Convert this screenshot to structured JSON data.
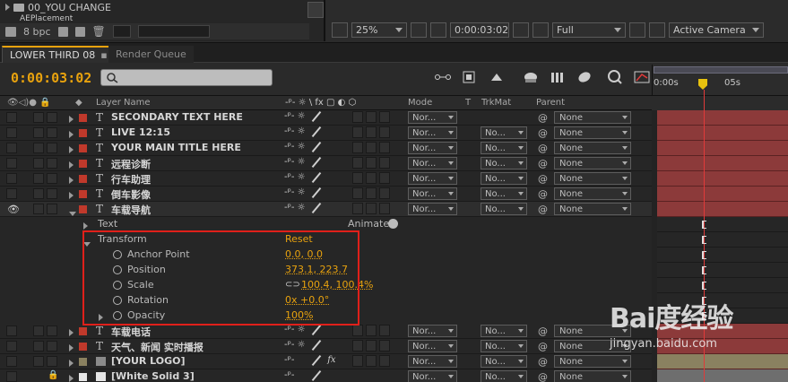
{
  "project": {
    "folder_label": "00_YOU CHANGE",
    "subfolder_label": "AEPlacement",
    "bit_depth": "8 bpc"
  },
  "viewer": {
    "zoom": "25%",
    "timecode": "0:00:03:02",
    "resolution": "Full",
    "camera": "Active Camera"
  },
  "tabs": [
    {
      "label": "LOWER THIRD 08"
    },
    {
      "label": "Render Queue"
    }
  ],
  "timeline": {
    "current_time": "0:00:03:02",
    "search_placeholder": "",
    "ruler_labels": [
      "0:00s",
      "05s"
    ]
  },
  "columns": {
    "layer_name": "Layer Name",
    "mode": "Mode",
    "t": "T",
    "trkmat": "TrkMat",
    "parent": "Parent"
  },
  "layers": [
    {
      "name": "SECONDARY TEXT HERE",
      "mode": "Nor...",
      "trkmat": "",
      "parent": "None"
    },
    {
      "name": "LIVE 12:15",
      "mode": "Nor...",
      "trkmat": "No...",
      "parent": "None"
    },
    {
      "name": "YOUR MAIN TITLE HERE",
      "mode": "Nor...",
      "trkmat": "No...",
      "parent": "None"
    },
    {
      "name": "远程诊断",
      "mode": "Nor...",
      "trkmat": "No...",
      "parent": "None"
    },
    {
      "name": "行车助理",
      "mode": "Nor...",
      "trkmat": "No...",
      "parent": "None"
    },
    {
      "name": "倒车影像",
      "mode": "Nor...",
      "trkmat": "No...",
      "parent": "None"
    },
    {
      "name": "车载导航",
      "mode": "Nor...",
      "trkmat": "No...",
      "parent": "None"
    }
  ],
  "expanded": {
    "text_label": "Text",
    "animate_label": "Animate:",
    "transform_label": "Transform",
    "reset_label": "Reset",
    "properties": [
      {
        "name": "Anchor Point",
        "value": "0.0, 0.0"
      },
      {
        "name": "Position",
        "value": "373.1, 223.7"
      },
      {
        "name": "Scale",
        "value": "100.4, 100.4%"
      },
      {
        "name": "Rotation",
        "value": "0x +0.0°"
      },
      {
        "name": "Opacity",
        "value": "100%"
      }
    ]
  },
  "layers_after": [
    {
      "name": "车载电话",
      "mode": "Nor...",
      "trkmat": "No...",
      "parent": "None"
    },
    {
      "name": "天气、新闻 实时播报",
      "mode": "Nor...",
      "trkmat": "No...",
      "parent": "None"
    },
    {
      "name": "[YOUR LOGO]",
      "mode": "Nor...",
      "trkmat": "No...",
      "parent": "None"
    },
    {
      "name": "[White Solid 3]",
      "mode": "Nor...",
      "trkmat": "No...",
      "parent": "None"
    }
  ],
  "watermark": {
    "logo": "Bai度经验",
    "url": "jingyan.baidu.com"
  },
  "colors": {
    "accent": "#e8a20e",
    "label_red": "#c0392b",
    "highlight": "#e0201a"
  }
}
